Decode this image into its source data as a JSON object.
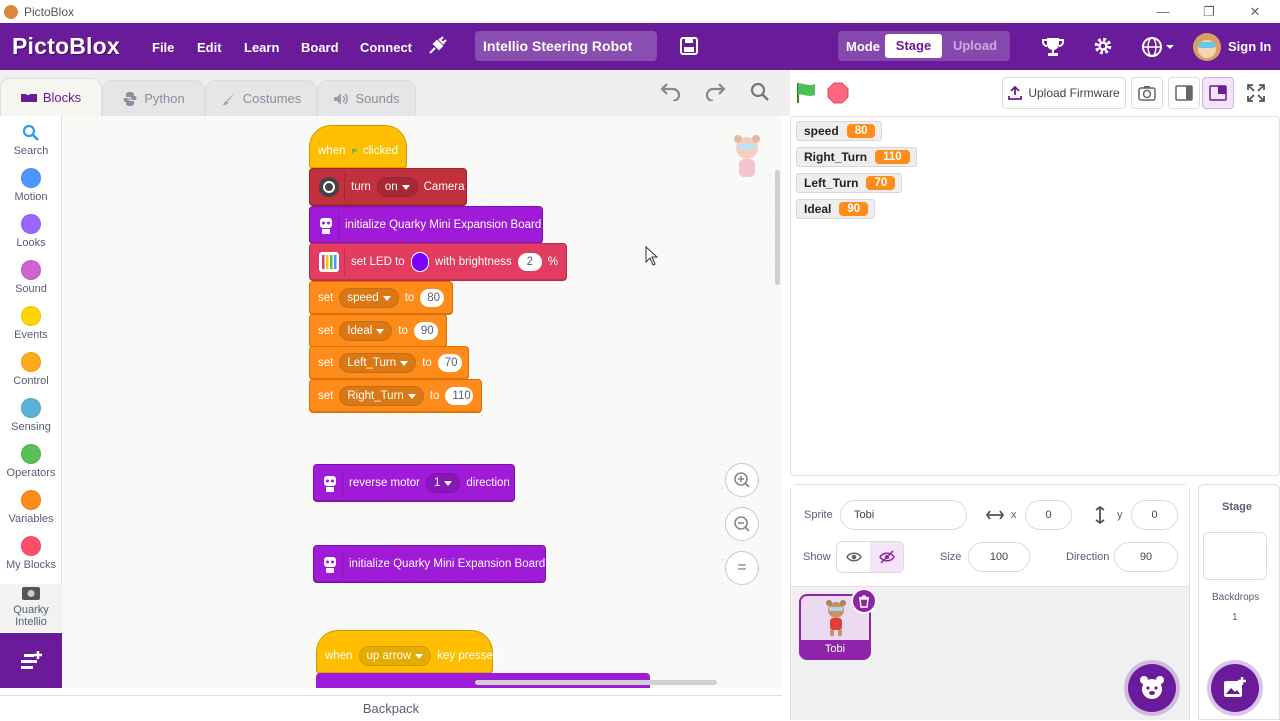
{
  "window": {
    "title": "PictoBlox",
    "minimize": "—",
    "maximize": "❐",
    "close": "✕"
  },
  "menubar": {
    "logo": "PictoBlox",
    "items": [
      "File",
      "Edit",
      "Learn",
      "Board",
      "Connect"
    ],
    "project_name": "Intellio Steering Robot",
    "mode_label": "Mode",
    "mode_stage": "Stage",
    "mode_upload": "Upload",
    "sign_in": "Sign In"
  },
  "tabs": {
    "blocks": "Blocks",
    "python": "Python",
    "costumes": "Costumes",
    "sounds": "Sounds"
  },
  "categories": [
    {
      "label": "Search",
      "color": ""
    },
    {
      "label": "Motion",
      "color": "#4c97ff"
    },
    {
      "label": "Looks",
      "color": "#9966ff"
    },
    {
      "label": "Sound",
      "color": "#cf63cf"
    },
    {
      "label": "Events",
      "color": "#ffd500"
    },
    {
      "label": "Control",
      "color": "#ffab19"
    },
    {
      "label": "Sensing",
      "color": "#5cb1d6"
    },
    {
      "label": "Operators",
      "color": "#59c059"
    },
    {
      "label": "Variables",
      "color": "#ff8c1a"
    },
    {
      "label": "My Blocks",
      "color": "#ff4d6a"
    },
    {
      "label": "Quarky Intellio",
      "color": ""
    }
  ],
  "blocks": {
    "hat1_when": "when",
    "hat1_clicked": "clicked",
    "camera_turn": "turn",
    "camera_state": "on",
    "camera_label": "Camera",
    "init1": "initialize Quarky Mini Expansion Board",
    "led_set": "set LED to",
    "led_with": "with brightness",
    "led_brightness": "2",
    "led_pct": "%",
    "set_word": "set",
    "to_word": "to",
    "var_speed": "speed",
    "val_speed": "80",
    "var_ideal": "Ideal",
    "val_ideal": "90",
    "var_left": "Left_Turn",
    "val_left": "70",
    "var_right": "Right_Turn",
    "val_right": "110",
    "reverse_label": "reverse motor",
    "reverse_motor": "1",
    "reverse_direction": "direction",
    "init2": "initialize Quarky Mini Expansion Board",
    "hat2_when": "when",
    "hat2_key": "up arrow",
    "hat2_pressed": "key pressed"
  },
  "zoom": {
    "in": "+",
    "out": "−",
    "reset": "="
  },
  "backpack": "Backpack",
  "stage_toolbar": {
    "upload_firmware": "Upload Firmware"
  },
  "monitors": [
    {
      "name": "speed",
      "value": "80"
    },
    {
      "name": "Right_Turn",
      "value": "110"
    },
    {
      "name": "Left_Turn",
      "value": "70"
    },
    {
      "name": "Ideal",
      "value": "90"
    }
  ],
  "sprite_info": {
    "sprite_label": "Sprite",
    "sprite_name": "Tobi",
    "x_label": "x",
    "x_value": "0",
    "y_label": "y",
    "y_value": "0",
    "show_label": "Show",
    "size_label": "Size",
    "size_value": "100",
    "direction_label": "Direction",
    "direction_value": "90"
  },
  "sprites": [
    {
      "name": "Tobi"
    }
  ],
  "stage_panel": {
    "title": "Stage",
    "backdrops_label": "Backdrops",
    "backdrops_count": "1"
  },
  "colors": {
    "brand": "#6a1b9a",
    "events": "#ffbf00",
    "variables": "#ff8c1a",
    "quarky": "#9f1bd8"
  }
}
